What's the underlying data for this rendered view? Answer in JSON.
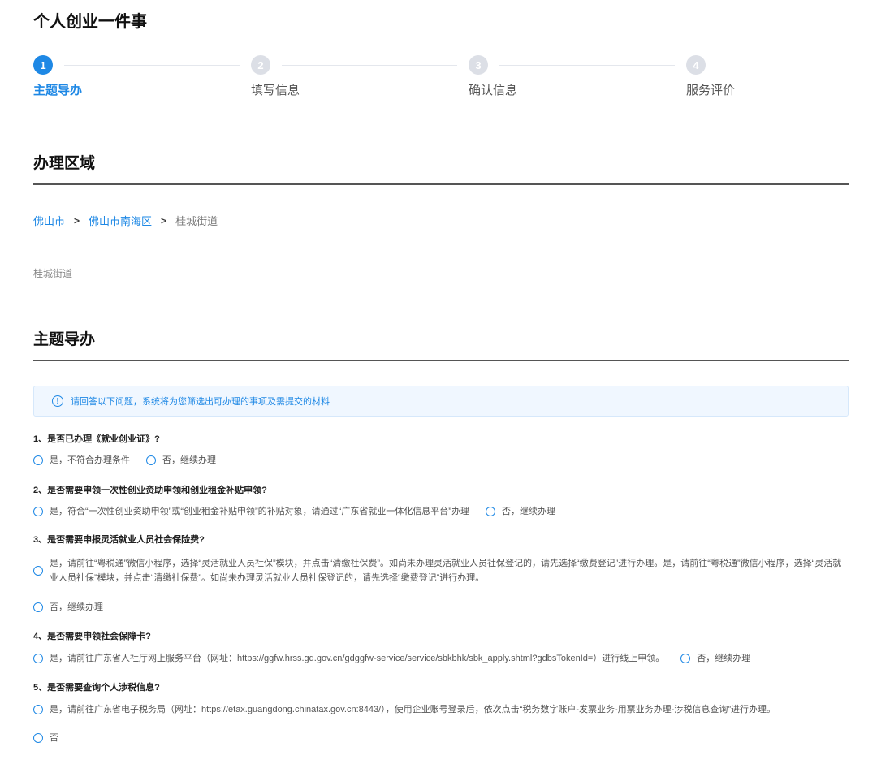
{
  "page": {
    "title": "个人创业一件事"
  },
  "stepper": {
    "steps": [
      {
        "number": "1",
        "label": "主题导办"
      },
      {
        "number": "2",
        "label": "填写信息"
      },
      {
        "number": "3",
        "label": "确认信息"
      },
      {
        "number": "4",
        "label": "服务评价"
      }
    ]
  },
  "region": {
    "title": "办理区域",
    "breadcrumb": {
      "city": "佛山市",
      "district": "佛山市南海区",
      "street": "桂城街道"
    },
    "selected": "桂城街道"
  },
  "guide": {
    "title": "主题导办",
    "notice_icon": "!",
    "notice": "请回答以下问题，系统将为您筛选出可办理的事项及需提交的材料",
    "questions": [
      {
        "title": "1、是否已办理《就业创业证》?",
        "options": [
          "是，不符合办理条件",
          "否，继续办理"
        ]
      },
      {
        "title": "2、是否需要申领一次性创业资助申领和创业租金补贴申领?",
        "options": [
          "是，符合“一次性创业资助申领”或“创业租金补贴申领”的补贴对象，请通过“广东省就业一体化信息平台”办理",
          "否，继续办理"
        ]
      },
      {
        "title": "3、是否需要申报灵活就业人员社会保险费?",
        "options": [
          "是，请前往“粤税通”微信小程序，选择“灵活就业人员社保”模块，并点击“清缴社保费”。如尚未办理灵活就业人员社保登记的，请先选择“缴费登记”进行办理。是，请前往“粤税通”微信小程序，选择“灵活就业人员社保”模块，并点击“清缴社保费”。如尚未办理灵活就业人员社保登记的，请先选择“缴费登记”进行办理。",
          "否，继续办理"
        ]
      },
      {
        "title": "4、是否需要申领社会保障卡?",
        "options": [
          "是，请前往广东省人社厅网上服务平台（网址：https://ggfw.hrss.gd.gov.cn/gdggfw-service/service/sbkbhk/sbk_apply.shtml?gdbsTokenId=）进行线上申领。",
          "否，继续办理"
        ]
      },
      {
        "title": "5、是否需要查询个人涉税信息?",
        "options": [
          "是，请前往广东省电子税务局（网址：https://etax.guangdong.chinatax.gov.cn:8443/），使用企业账号登录后，依次点击“税务数字账户-发票业务-用票业务办理-涉税信息查询”进行办理。",
          "否"
        ]
      }
    ]
  },
  "colors": {
    "accent": "#1e88e5",
    "notice_bg": "#f0f7ff"
  }
}
